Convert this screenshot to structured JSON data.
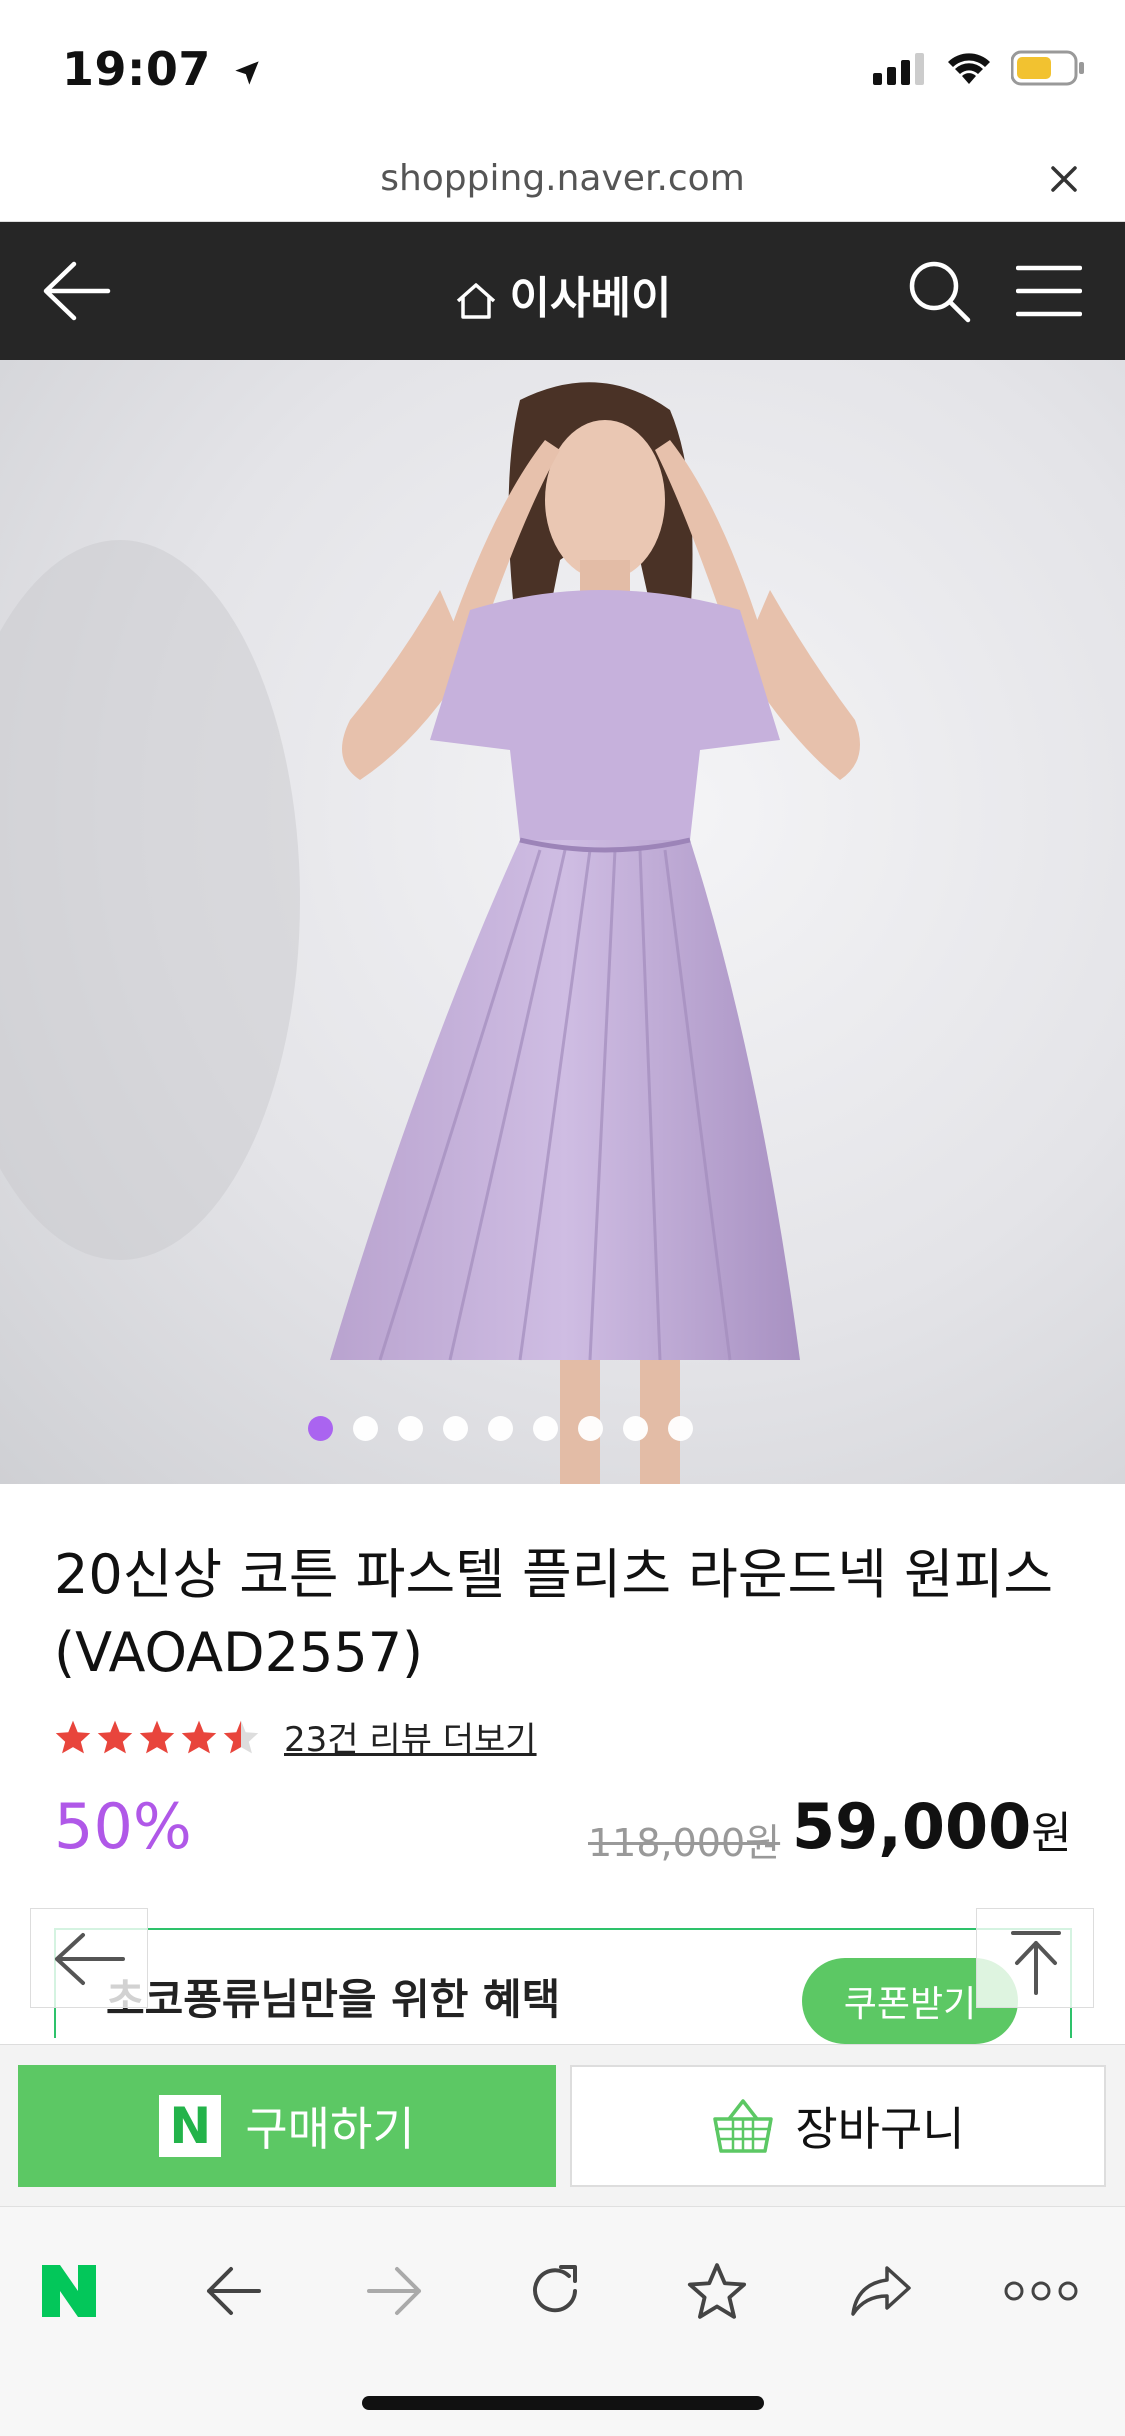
{
  "status_bar": {
    "time": "19:07",
    "icons": [
      "location-arrow-icon",
      "signal-icon",
      "wifi-icon",
      "battery-icon"
    ],
    "battery_color": "#f2c230"
  },
  "browser": {
    "url": "shopping.naver.com"
  },
  "nav": {
    "title": "이사베이"
  },
  "gallery": {
    "total_images": 9,
    "current_index": 1,
    "active_dot_color": "#a85ef0"
  },
  "product": {
    "title": "20신상 코튼 파스텔 플리츠 라운드넥 원피스 (VAOAD2557)",
    "rating": 4.5,
    "review_link": "23건 리뷰 더보기",
    "discount": "50%",
    "original_price": "118,000원",
    "sale_price": "59,000",
    "currency": "원"
  },
  "benefit": {
    "label": "초코퐁류님만을 위한 혜택",
    "coupon_button": "쿠폰받기"
  },
  "actions": {
    "buy_label": "구매하기",
    "n_logo": "N",
    "cart_label": "장바구니"
  },
  "colors": {
    "brand_green": "#5cc864",
    "discount_purple": "#b058e8",
    "nav_dark": "#262626",
    "star_red": "#e8453c"
  },
  "toolbar": {
    "items": [
      "naver-logo",
      "back",
      "forward",
      "reload",
      "bookmark",
      "share",
      "more"
    ]
  }
}
